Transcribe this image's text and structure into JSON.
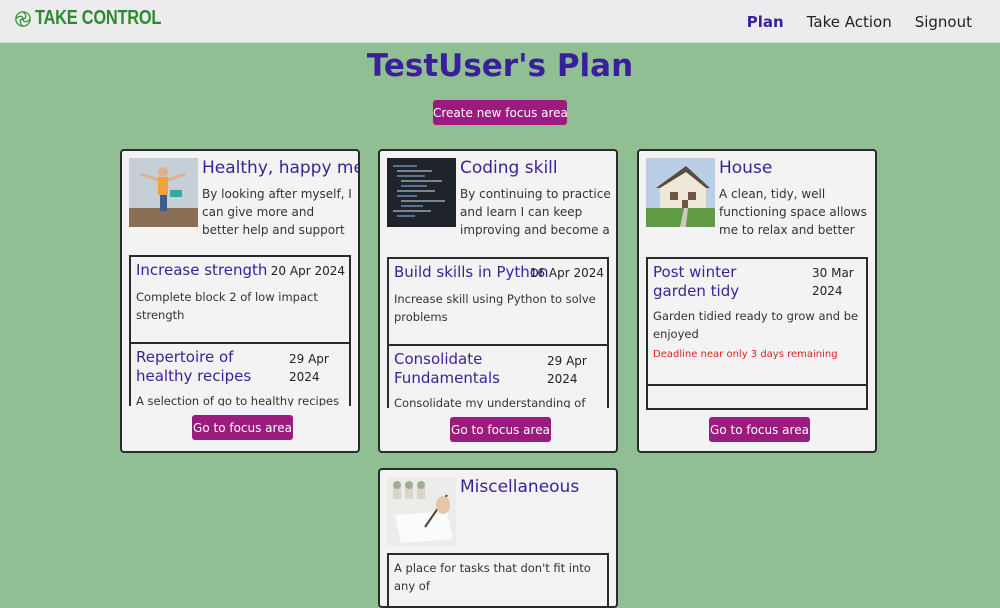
{
  "brand": {
    "name": "TAKE CONTROL"
  },
  "nav": {
    "plan": "Plan",
    "take_action": "Take Action",
    "signout": "Signout"
  },
  "page": {
    "title": "TestUser's Plan",
    "create_button": "Create new focus area"
  },
  "cards": [
    {
      "title": "Healthy, happy me",
      "description": "By looking after myself, I can give more and better help and support others.",
      "goto": "Go to focus area",
      "tasks": [
        {
          "title": "Increase strength",
          "date": "20 Apr 2024",
          "desc": "Complete block 2 of low impact strength"
        },
        {
          "title": "Repertoire of healthy recipes",
          "date": "29 Apr 2024",
          "desc": "A selection of go to healthy recipes to"
        }
      ]
    },
    {
      "title": "Coding skill",
      "description": "By continuing to practice and learn I can keep improving and become a better coder",
      "goto": "Go to focus area",
      "tasks": [
        {
          "title": "Build skills in Python",
          "date": "16 Apr 2024",
          "desc": "Increase skill using Python to solve problems"
        },
        {
          "title": "Consolidate Fundamentals",
          "date": "29 Apr 2024",
          "desc": "Consolidate my understanding of the"
        }
      ]
    },
    {
      "title": "House",
      "description": "A clean, tidy, well functioning space allows me to relax and better achieve what I need to do",
      "goto": "Go to focus area",
      "tasks": [
        {
          "title": "Post winter garden tidy",
          "date": "30 Mar 2024",
          "desc": "Garden tidied ready to grow and be enjoyed",
          "warning": "Deadline near only 3 days remaining"
        }
      ]
    },
    {
      "title": "Miscellaneous",
      "description": "A place for tasks that don't fit into any of"
    }
  ],
  "colors": {
    "accent": "#3a1f9b",
    "button": "#9b1b7e",
    "background": "#90bf93",
    "warning": "#e02020",
    "brand": "#2e8a2e"
  }
}
